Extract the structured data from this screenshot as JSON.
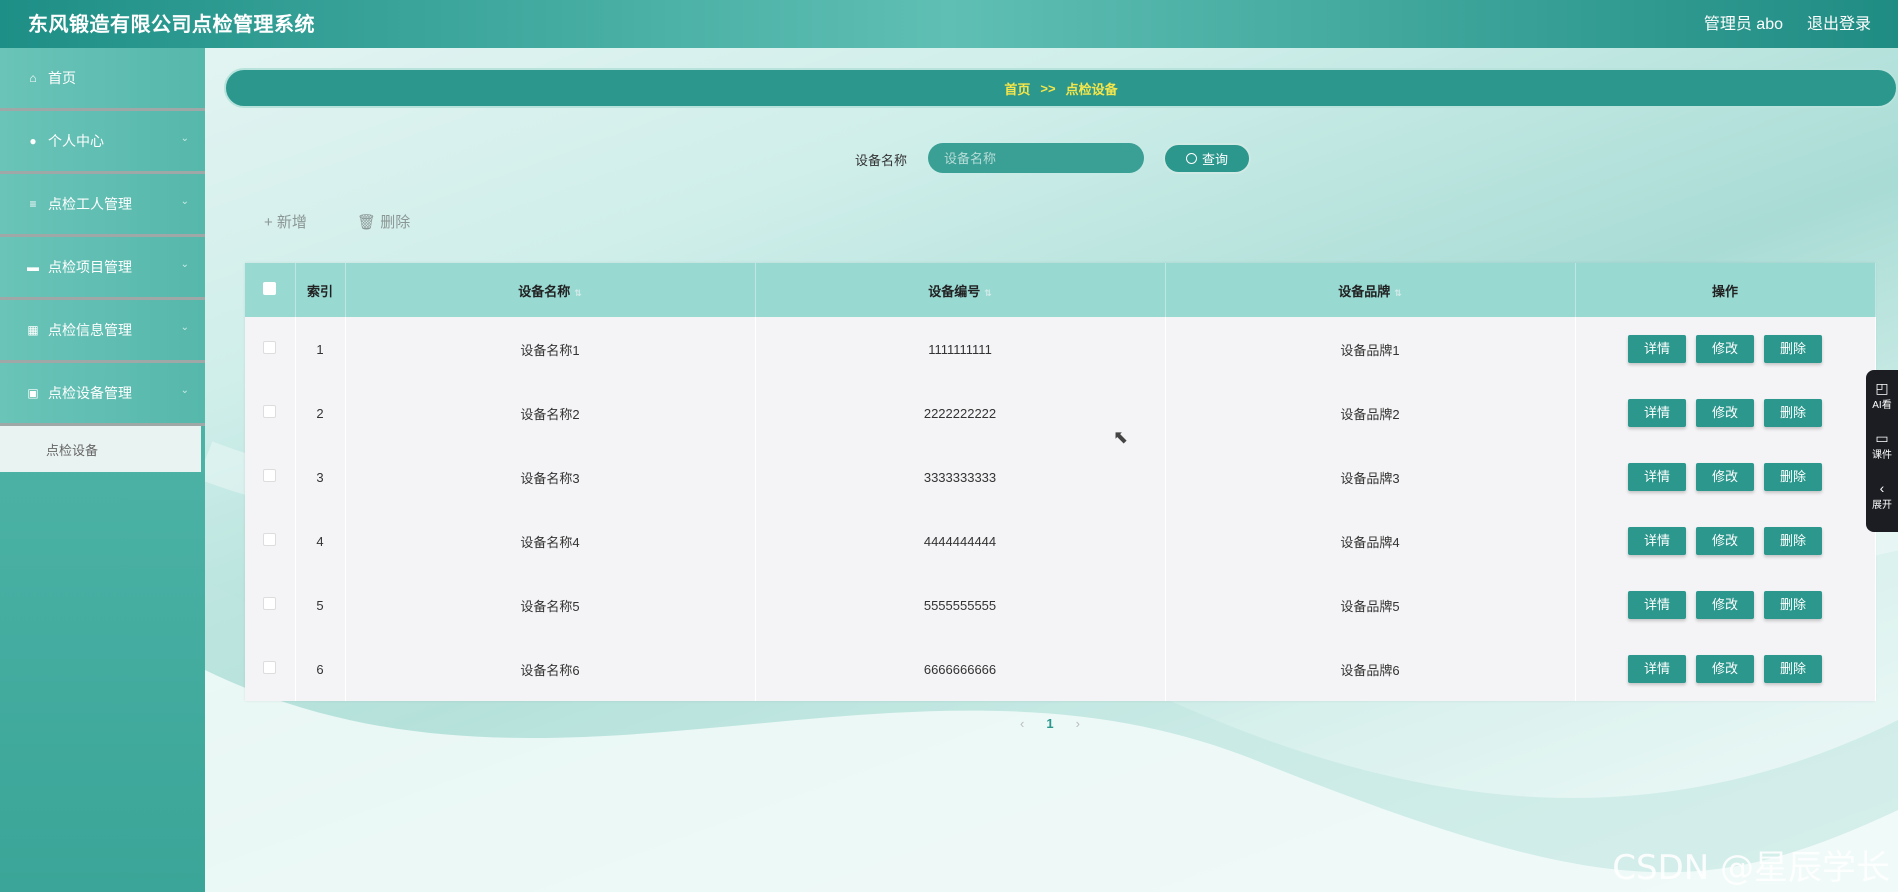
{
  "app": {
    "title": "东风锻造有限公司点检管理系统",
    "user": "管理员 abo",
    "logout": "退出登录"
  },
  "sidebar": {
    "items": [
      {
        "label": "首页",
        "icon": "home-icon"
      },
      {
        "label": "个人中心",
        "icon": "user-icon"
      },
      {
        "label": "点检工人管理",
        "icon": "list-icon"
      },
      {
        "label": "点检项目管理",
        "icon": "chat-icon"
      },
      {
        "label": "点检信息管理",
        "icon": "grid-icon"
      },
      {
        "label": "点检设备管理",
        "icon": "briefcase-icon"
      }
    ],
    "sub_items": [
      {
        "label": "点检设备"
      }
    ]
  },
  "breadcrumb": {
    "home": "首页",
    "separator": ">>",
    "current": "点检设备"
  },
  "search": {
    "label": "设备名称",
    "placeholder": "设备名称",
    "value": "",
    "button": "查询"
  },
  "toolbar": {
    "add": "+ 新增",
    "delete": "删除"
  },
  "table": {
    "headers": [
      "索引",
      "设备名称",
      "设备编号",
      "设备品牌",
      "操作"
    ],
    "rows": [
      {
        "index": "1",
        "name": "设备名称1",
        "code": "1111111111",
        "brand": "设备品牌1"
      },
      {
        "index": "2",
        "name": "设备名称2",
        "code": "2222222222",
        "brand": "设备品牌2"
      },
      {
        "index": "3",
        "name": "设备名称3",
        "code": "3333333333",
        "brand": "设备品牌3"
      },
      {
        "index": "4",
        "name": "设备名称4",
        "code": "4444444444",
        "brand": "设备品牌4"
      },
      {
        "index": "5",
        "name": "设备名称5",
        "code": "5555555555",
        "brand": "设备品牌5"
      },
      {
        "index": "6",
        "name": "设备名称6",
        "code": "6666666666",
        "brand": "设备品牌6"
      }
    ],
    "actions": {
      "detail": "详情",
      "edit": "修改",
      "delete": "删除"
    }
  },
  "pagination": {
    "prev": "‹",
    "current": "1",
    "next": "›"
  },
  "float_panel": [
    {
      "label": "AI看"
    },
    {
      "label": "课件"
    },
    {
      "label": "展开"
    }
  ],
  "watermark": "CSDN @星辰学长",
  "colors": {
    "accent": "#2b978d",
    "header_row": "#98d9d2",
    "breadcrumb_text": "#f5e64a"
  }
}
